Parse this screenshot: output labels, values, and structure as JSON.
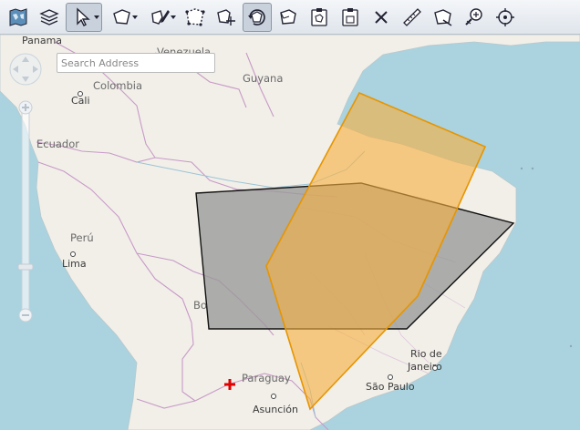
{
  "toolbar": {
    "tools": [
      {
        "icon": "map-layers-icon"
      },
      {
        "icon": "stacked-layers-icon"
      },
      {
        "icon": "select-pointer-icon",
        "has_dropdown": true,
        "active": true
      },
      {
        "icon": "draw-polygon-icon",
        "has_dropdown": true
      },
      {
        "icon": "edit-polygon-icon",
        "has_dropdown": true
      },
      {
        "icon": "reshape-polygon-icon"
      },
      {
        "icon": "move-polygon-icon"
      },
      {
        "icon": "rotate-polygon-icon",
        "active": true
      },
      {
        "icon": "copy-polygon-icon"
      },
      {
        "icon": "paste-polygon-icon"
      },
      {
        "icon": "paste-clipboard-icon"
      },
      {
        "icon": "delete-icon"
      },
      {
        "icon": "measure-ruler-icon"
      },
      {
        "icon": "measure-area-icon"
      },
      {
        "icon": "zoom-to-feature-icon"
      },
      {
        "icon": "locate-target-icon"
      }
    ]
  },
  "search": {
    "placeholder": "Search Address",
    "value": ""
  },
  "map": {
    "labels": {
      "panama": "Panama",
      "venezuela": "Venezuela",
      "guyana": "Guyana",
      "colombia": "Colombia",
      "cali": "Cali",
      "ecuador": "Ecuador",
      "peru": "Perú",
      "lima": "Lima",
      "bolivia_partial": "Bo",
      "paraguay": "Paraguay",
      "asuncion": "Asunción",
      "rio_de": "Rio de",
      "janeiro": "Janeiro",
      "sao_paulo": "São Paulo"
    },
    "colors": {
      "ocean": "#aad3df",
      "land": "#f2efe9",
      "border": "#c79ac7",
      "gray_polygon_fill": "#999999",
      "gray_polygon_stroke": "#111111",
      "orange_polygon_fill": "#f5b041",
      "orange_polygon_stroke": "#e69500",
      "marker": "#e00000"
    }
  }
}
